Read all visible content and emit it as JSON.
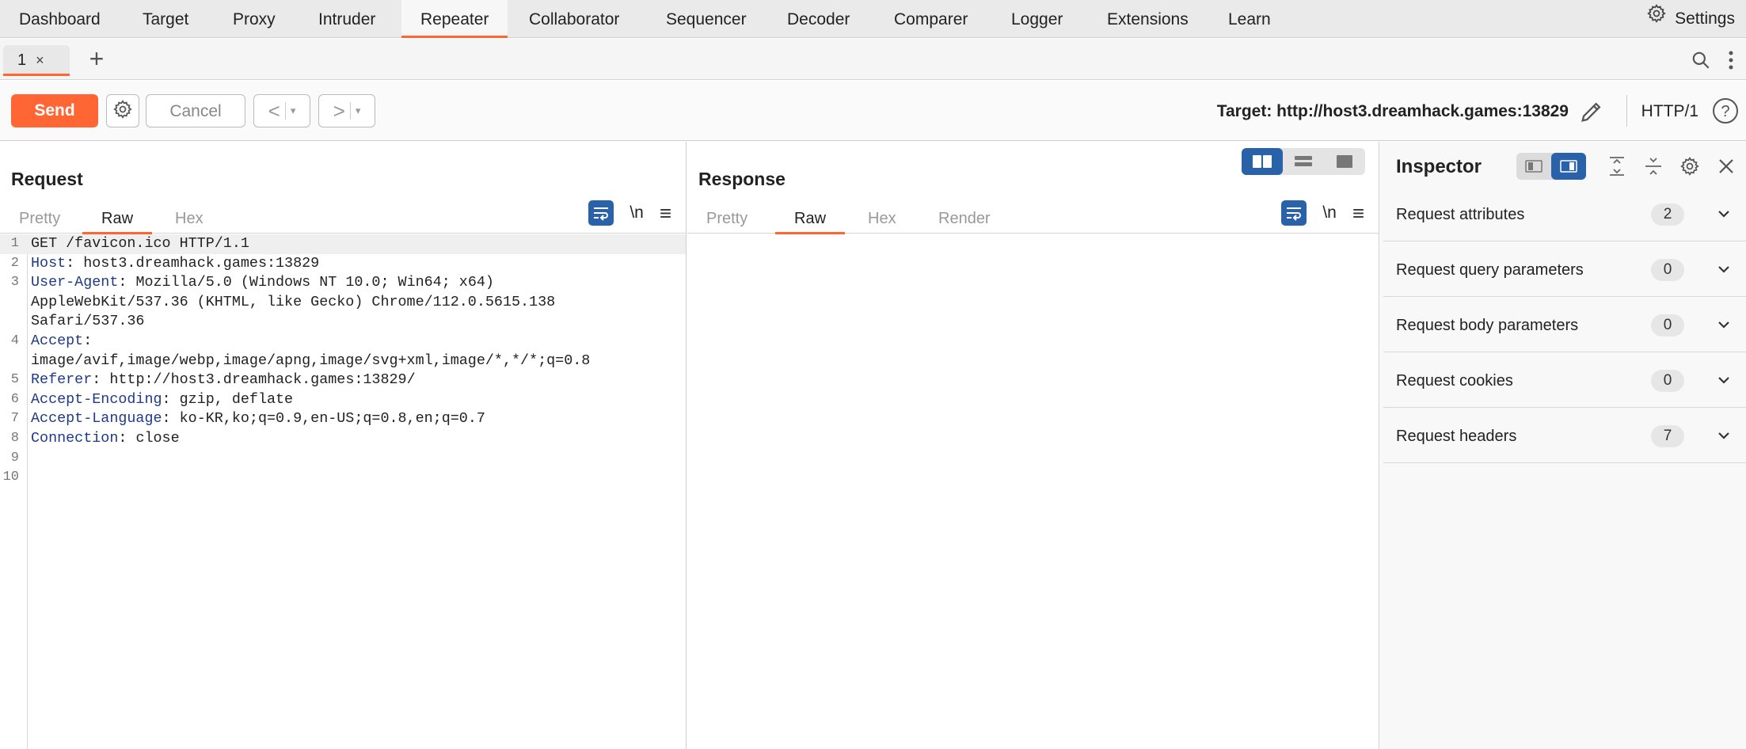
{
  "nav": {
    "items": [
      "Dashboard",
      "Target",
      "Proxy",
      "Intruder",
      "Repeater",
      "Collaborator",
      "Sequencer",
      "Decoder",
      "Comparer",
      "Logger",
      "Extensions",
      "Learn"
    ],
    "active": "Repeater",
    "settings_label": "Settings"
  },
  "tabs": {
    "items": [
      {
        "label": "1",
        "close": "×"
      }
    ],
    "add_label": "+"
  },
  "toolbar": {
    "send_label": "Send",
    "cancel_label": "Cancel",
    "prev_label": "<",
    "next_label": ">",
    "dropdown_glyph": "▾",
    "target_label": "Target: http://host3.dreamhack.games:13829",
    "protocol_label": "HTTP/1",
    "help_label": "?"
  },
  "request": {
    "title": "Request",
    "tabs": [
      "Pretty",
      "Raw",
      "Hex"
    ],
    "active_tab": "Raw",
    "newline_label": "\\n",
    "menu_label": "≡",
    "lines": [
      {
        "num": "1",
        "key": "",
        "text": "GET /favicon.ico HTTP/1.1"
      },
      {
        "num": "2",
        "key": "Host",
        "text": ": host3.dreamhack.games:13829"
      },
      {
        "num": "3",
        "key": "User-Agent",
        "text": ": Mozilla/5.0 (Windows NT 10.0; Win64; x64)"
      },
      {
        "num": "",
        "key": "",
        "text": "AppleWebKit/537.36 (KHTML, like Gecko) Chrome/112.0.5615.138"
      },
      {
        "num": "",
        "key": "",
        "text": "Safari/537.36"
      },
      {
        "num": "4",
        "key": "Accept",
        "text": ":"
      },
      {
        "num": "",
        "key": "",
        "text": "image/avif,image/webp,image/apng,image/svg+xml,image/*,*/*;q=0.8"
      },
      {
        "num": "5",
        "key": "Referer",
        "text": ": http://host3.dreamhack.games:13829/"
      },
      {
        "num": "6",
        "key": "Accept-Encoding",
        "text": ": gzip, deflate"
      },
      {
        "num": "7",
        "key": "Accept-Language",
        "text": ": ko-KR,ko;q=0.9,en-US;q=0.8,en;q=0.7"
      },
      {
        "num": "8",
        "key": "Connection",
        "text": ": close"
      },
      {
        "num": "9",
        "key": "",
        "text": ""
      },
      {
        "num": "10",
        "key": "",
        "text": ""
      }
    ]
  },
  "response": {
    "title": "Response",
    "tabs": [
      "Pretty",
      "Raw",
      "Hex",
      "Render"
    ],
    "active_tab": "Raw",
    "newline_label": "\\n",
    "menu_label": "≡"
  },
  "inspector": {
    "title": "Inspector",
    "sections": [
      {
        "label": "Request attributes",
        "count": "2"
      },
      {
        "label": "Request query parameters",
        "count": "0"
      },
      {
        "label": "Request body parameters",
        "count": "0"
      },
      {
        "label": "Request cookies",
        "count": "0"
      },
      {
        "label": "Request headers",
        "count": "7"
      }
    ]
  },
  "colors": {
    "accent": "#ff6633",
    "selected_blue": "#2962a8",
    "header_key": "#1f3a8a"
  }
}
